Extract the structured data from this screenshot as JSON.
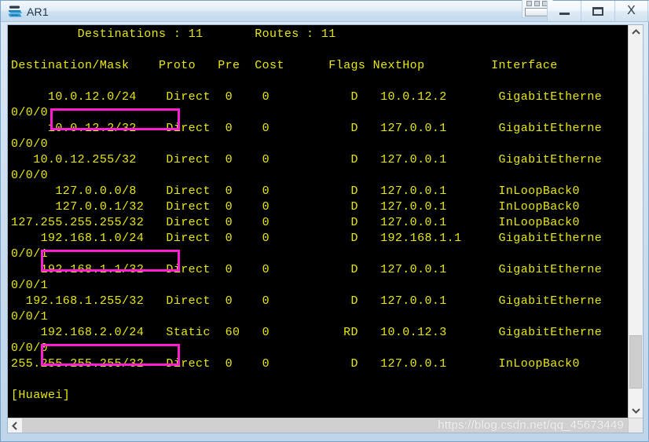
{
  "window": {
    "title": "AR1",
    "icon": "router-icon",
    "controls": {
      "tool_label": "",
      "minimize_label": "_",
      "maximize_label": "",
      "close_label": "X"
    }
  },
  "terminal": {
    "summary_line": "         Destinations : 11       Routes : 11",
    "header_line": "Destination/Mask    Proto   Pre  Cost      Flags NextHop         Interface",
    "prompt": "[Huawei]",
    "colors": {
      "foreground": "#e8e800",
      "background": "#000000",
      "annotation": "#ff1fd0"
    },
    "summary": {
      "destinations_label": "Destinations",
      "destinations_value": "11",
      "routes_label": "Routes",
      "routes_value": "11"
    },
    "columns": [
      "Destination/Mask",
      "Proto",
      "Pre",
      "Cost",
      "Flags",
      "NextHop",
      "Interface"
    ],
    "body": "         Destinations : 11       Routes : 11\n\nDestination/Mask    Proto   Pre  Cost      Flags NextHop         Interface\n\n     10.0.12.0/24    Direct  0    0           D   10.0.12.2       GigabitEtherne\n0/0/0\n     10.0.12.2/32    Direct  0    0           D   127.0.0.1       GigabitEtherne\n0/0/0\n   10.0.12.255/32    Direct  0    0           D   127.0.0.1       GigabitEtherne\n0/0/0\n      127.0.0.0/8    Direct  0    0           D   127.0.0.1       InLoopBack0\n      127.0.0.1/32   Direct  0    0           D   127.0.0.1       InLoopBack0\n127.255.255.255/32   Direct  0    0           D   127.0.0.1       InLoopBack0\n    192.168.1.0/24   Direct  0    0           D   192.168.1.1     GigabitEtherne\n0/0/1\n    192.168.1.1/32   Direct  0    0           D   127.0.0.1       GigabitEtherne\n0/0/1\n  192.168.1.255/32   Direct  0    0           D   127.0.0.1       GigabitEtherne\n0/0/1\n    192.168.2.0/24   Static  60   0          RD   10.0.12.3       GigabitEtherne\n0/0/0\n255.255.255.255/32   Direct  0    0           D   127.0.0.1       InLoopBack0\n\n[Huawei]",
    "routes": [
      {
        "destination": "10.0.12.0/24",
        "proto": "Direct",
        "pre": "0",
        "cost": "0",
        "flags": "D",
        "nexthop": "10.0.12.2",
        "interface": "GigabitEtherne",
        "interface_wrap": "0/0/0",
        "highlighted": true
      },
      {
        "destination": "10.0.12.2/32",
        "proto": "Direct",
        "pre": "0",
        "cost": "0",
        "flags": "D",
        "nexthop": "127.0.0.1",
        "interface": "GigabitEtherne",
        "interface_wrap": "0/0/0",
        "highlighted": false
      },
      {
        "destination": "10.0.12.255/32",
        "proto": "Direct",
        "pre": "0",
        "cost": "0",
        "flags": "D",
        "nexthop": "127.0.0.1",
        "interface": "GigabitEtherne",
        "interface_wrap": "0/0/0",
        "highlighted": false
      },
      {
        "destination": "127.0.0.0/8",
        "proto": "Direct",
        "pre": "0",
        "cost": "0",
        "flags": "D",
        "nexthop": "127.0.0.1",
        "interface": "InLoopBack0",
        "interface_wrap": "",
        "highlighted": false
      },
      {
        "destination": "127.0.0.1/32",
        "proto": "Direct",
        "pre": "0",
        "cost": "0",
        "flags": "D",
        "nexthop": "127.0.0.1",
        "interface": "InLoopBack0",
        "interface_wrap": "",
        "highlighted": false
      },
      {
        "destination": "127.255.255.255/32",
        "proto": "Direct",
        "pre": "0",
        "cost": "0",
        "flags": "D",
        "nexthop": "127.0.0.1",
        "interface": "InLoopBack0",
        "interface_wrap": "",
        "highlighted": false
      },
      {
        "destination": "192.168.1.0/24",
        "proto": "Direct",
        "pre": "0",
        "cost": "0",
        "flags": "D",
        "nexthop": "192.168.1.1",
        "interface": "GigabitEtherne",
        "interface_wrap": "0/0/1",
        "highlighted": true
      },
      {
        "destination": "192.168.1.1/32",
        "proto": "Direct",
        "pre": "0",
        "cost": "0",
        "flags": "D",
        "nexthop": "127.0.0.1",
        "interface": "GigabitEtherne",
        "interface_wrap": "0/0/1",
        "highlighted": false
      },
      {
        "destination": "192.168.1.255/32",
        "proto": "Direct",
        "pre": "0",
        "cost": "0",
        "flags": "D",
        "nexthop": "127.0.0.1",
        "interface": "GigabitEtherne",
        "interface_wrap": "0/0/1",
        "highlighted": false
      },
      {
        "destination": "192.168.2.0/24",
        "proto": "Static",
        "pre": "60",
        "cost": "0",
        "flags": "RD",
        "nexthop": "10.0.12.3",
        "interface": "GigabitEtherne",
        "interface_wrap": "0/0/0",
        "highlighted": true
      },
      {
        "destination": "255.255.255.255/32",
        "proto": "Direct",
        "pre": "0",
        "cost": "0",
        "flags": "D",
        "nexthop": "127.0.0.1",
        "interface": "InLoopBack0",
        "interface_wrap": "",
        "highlighted": false
      }
    ]
  },
  "scrollbars": {
    "vertical_up": "˄",
    "vertical_down": "˅",
    "horizontal_left": "‹",
    "horizontal_right": "›"
  },
  "watermark": {
    "text": "https://blog.csdn.net/qq_45673449"
  }
}
